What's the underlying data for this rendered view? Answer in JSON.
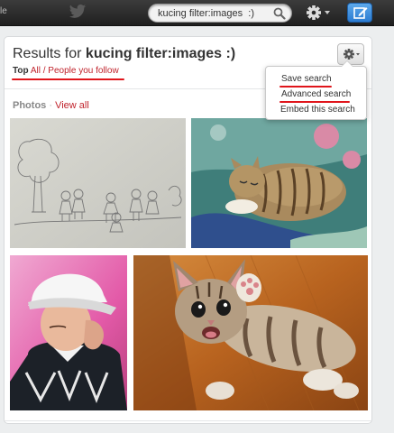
{
  "topbar": {
    "edge_text": "le",
    "search_value": "kucing filter:images  :)",
    "search_icon": "magnifier-icon",
    "settings_icon": "gear-icon",
    "compose_icon": "compose-tweet-icon"
  },
  "results": {
    "prefix": "Results for",
    "query": "kucing filter:images :)",
    "filter_top": "Top",
    "filter_links": "All / People you follow"
  },
  "menu": {
    "items": [
      "Save search",
      "Advanced search",
      "Embed this search"
    ]
  },
  "photos": {
    "label": "Photos",
    "separator": "·",
    "view_all": "View all",
    "items": [
      {
        "name": "pencil-sketch-photo",
        "kind": "sketch"
      },
      {
        "name": "sleeping-tabby-cat-photo",
        "kind": "cat"
      },
      {
        "name": "boy-in-cap-photo",
        "kind": "person"
      },
      {
        "name": "playful-kitten-photo",
        "kind": "kitten"
      }
    ]
  },
  "colors": {
    "link_red": "#c0232c",
    "annotation_red": "#e0151b",
    "compose_blue": "#2b7bd1",
    "topbar_dark": "#2a2a2a"
  }
}
